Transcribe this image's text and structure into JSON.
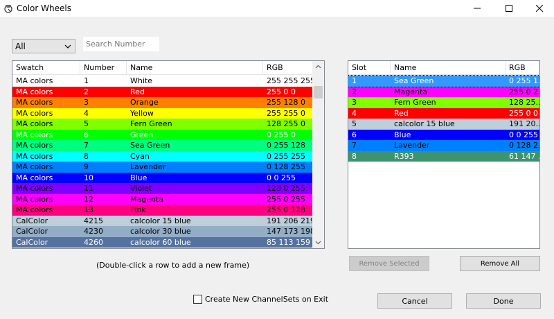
{
  "window": {
    "title": "Color Wheels",
    "icons": {
      "app": "color-wheel-app-icon",
      "minimize": "minimize-icon",
      "maximize": "maximize-icon",
      "close": "close-icon"
    }
  },
  "filter": {
    "selected": "All"
  },
  "search": {
    "placeholder": "Search Number"
  },
  "swatch_table": {
    "headers": {
      "swatch": "Swatch",
      "number": "Number",
      "name": "Name",
      "rgb": "RGB"
    },
    "rows": [
      {
        "swatch": "MA colors",
        "number": "1",
        "name": "White",
        "rgb": "255 255 255",
        "bg": "#ffffff",
        "fg": "#000000"
      },
      {
        "swatch": "MA colors",
        "number": "2",
        "name": "Red",
        "rgb": "255 0 0",
        "bg": "#ff0000",
        "fg": "#ffffff"
      },
      {
        "swatch": "MA colors",
        "number": "3",
        "name": "Orange",
        "rgb": "255 128 0",
        "bg": "#ff8000",
        "fg": "#000000"
      },
      {
        "swatch": "MA colors",
        "number": "4",
        "name": "Yellow",
        "rgb": "255 255 0",
        "bg": "#ffff00",
        "fg": "#000000"
      },
      {
        "swatch": "MA colors",
        "number": "5",
        "name": "Fern Green",
        "rgb": "128 255 0",
        "bg": "#80ff00",
        "fg": "#000000"
      },
      {
        "swatch": "MA colors",
        "number": "6",
        "name": "Green",
        "rgb": "0 255 0",
        "bg": "#00ff00",
        "fg": "#ffffff"
      },
      {
        "swatch": "MA colors",
        "number": "7",
        "name": "Sea Green",
        "rgb": "0 255 128",
        "bg": "#00ff80",
        "fg": "#000000"
      },
      {
        "swatch": "MA colors",
        "number": "8",
        "name": "Cyan",
        "rgb": "0 255 255",
        "bg": "#00ffff",
        "fg": "#000000"
      },
      {
        "swatch": "MA colors",
        "number": "9",
        "name": "Lavender",
        "rgb": "0 128 255",
        "bg": "#0080ff",
        "fg": "#000000"
      },
      {
        "swatch": "MA colors",
        "number": "10",
        "name": "Blue",
        "rgb": "0 0 255",
        "bg": "#0000ff",
        "fg": "#ffffff"
      },
      {
        "swatch": "MA colors",
        "number": "11",
        "name": "Violet",
        "rgb": "128 0 255",
        "bg": "#8000ff",
        "fg": "#000000"
      },
      {
        "swatch": "MA colors",
        "number": "12",
        "name": "Magenta",
        "rgb": "255 0 255",
        "bg": "#ff00ff",
        "fg": "#000000"
      },
      {
        "swatch": "MA colors",
        "number": "13",
        "name": "Pink",
        "rgb": "255 0 128",
        "bg": "#ff0080",
        "fg": "#000000"
      },
      {
        "swatch": "CalColor",
        "number": "4215",
        "name": "calcolor 15 blue",
        "rgb": "191 206 219",
        "bg": "#bfcedb",
        "fg": "#000000"
      },
      {
        "swatch": "CalColor",
        "number": "4230",
        "name": "calcolor 30 blue",
        "rgb": "147 173 198",
        "bg": "#93adc6",
        "fg": "#000000"
      },
      {
        "swatch": "CalColor",
        "number": "4260",
        "name": "calcolor 60 blue",
        "rgb": "85 113 159",
        "bg": "#55719f",
        "fg": "#ffffff"
      }
    ]
  },
  "slot_table": {
    "headers": {
      "slot": "Slot",
      "name": "Name",
      "rgb": "RGB"
    },
    "rows": [
      {
        "slot": "1",
        "name": "Sea Green",
        "rgb": "0 255 1...",
        "bg": "#3399ff",
        "fg": "#ffffff",
        "selected": true
      },
      {
        "slot": "2",
        "name": "Magenta",
        "rgb": "255 0 2...",
        "bg": "#ff00ff",
        "fg": "#000000"
      },
      {
        "slot": "3",
        "name": "Fern Green",
        "rgb": "128 25...",
        "bg": "#80ff00",
        "fg": "#000000"
      },
      {
        "slot": "4",
        "name": "Red",
        "rgb": "255 0 0",
        "bg": "#ff0000",
        "fg": "#ffffff"
      },
      {
        "slot": "5",
        "name": "calcolor 15 blue",
        "rgb": "191 20...",
        "bg": "#bfcedb",
        "fg": "#000000"
      },
      {
        "slot": "6",
        "name": "Blue",
        "rgb": "0 0 255",
        "bg": "#0000ff",
        "fg": "#ffffff"
      },
      {
        "slot": "7",
        "name": "Lavender",
        "rgb": "0 128 2...",
        "bg": "#0080ff",
        "fg": "#000000"
      },
      {
        "slot": "8",
        "name": "R393",
        "rgb": "61 147 ...",
        "bg": "#3d9370",
        "fg": "#ffffff"
      }
    ]
  },
  "hint": "(Double-click a row to add a new frame)",
  "buttons": {
    "remove_selected": "Remove Selected",
    "remove_all": "Remove All",
    "cancel": "Cancel",
    "done": "Done"
  },
  "checkbox": {
    "label": "Create New ChannelSets on Exit",
    "checked": false
  }
}
